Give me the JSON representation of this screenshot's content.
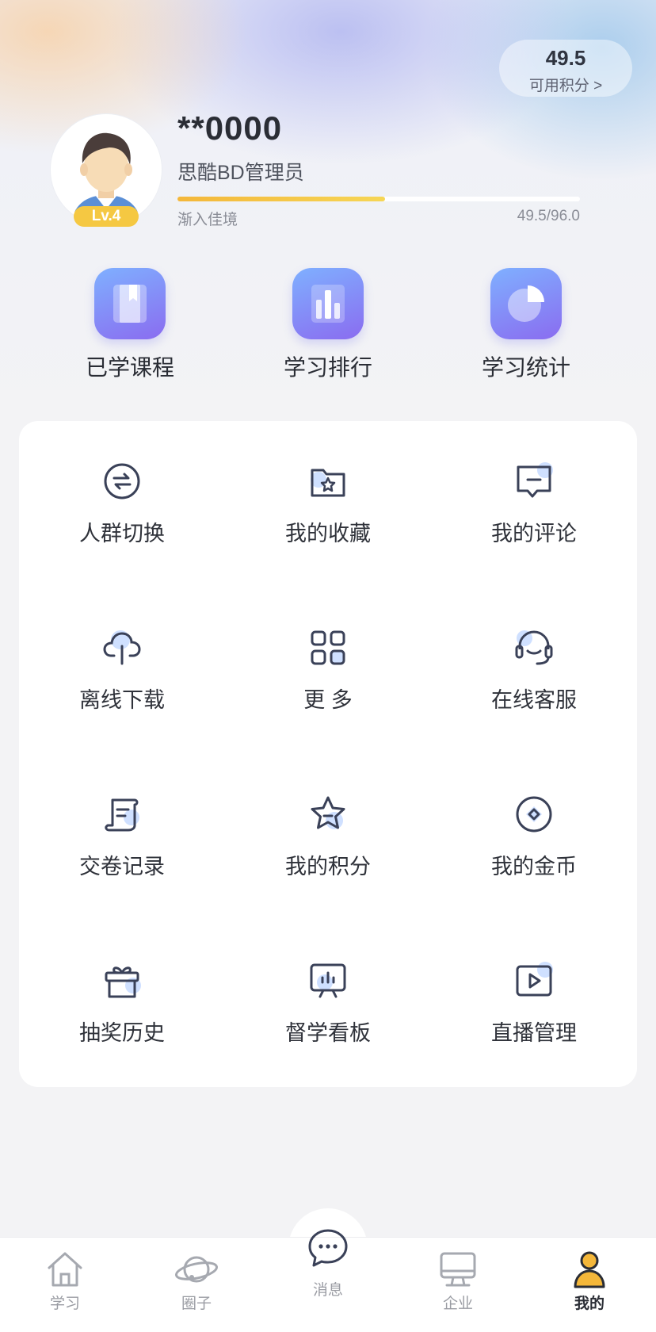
{
  "points": {
    "value": "49.5",
    "label": "可用积分 >"
  },
  "profile": {
    "name": "**0000",
    "role": "思酷BD管理员",
    "level": "Lv.4",
    "rank_title": "渐入佳境",
    "progress_text": "49.5/96.0",
    "progress_fraction": 0.515
  },
  "quick_actions": [
    {
      "label": "已学课程",
      "icon": "book-icon"
    },
    {
      "label": "学习排行",
      "icon": "bar-chart-icon"
    },
    {
      "label": "学习统计",
      "icon": "pie-chart-icon"
    }
  ],
  "menu": [
    {
      "label": "人群切换",
      "icon": "switch-icon"
    },
    {
      "label": "我的收藏",
      "icon": "star-folder-icon"
    },
    {
      "label": "我的评论",
      "icon": "comment-icon"
    },
    {
      "label": "离线下载",
      "icon": "cloud-download-icon"
    },
    {
      "label": "更 多",
      "icon": "grid-icon"
    },
    {
      "label": "在线客服",
      "icon": "headset-icon"
    },
    {
      "label": "交卷记录",
      "icon": "scroll-icon"
    },
    {
      "label": "我的积分",
      "icon": "star-icon"
    },
    {
      "label": "我的金币",
      "icon": "coin-icon"
    },
    {
      "label": "抽奖历史",
      "icon": "gift-icon"
    },
    {
      "label": "督学看板",
      "icon": "dashboard-icon"
    },
    {
      "label": "直播管理",
      "icon": "live-icon"
    }
  ],
  "tabs": [
    {
      "label": "学习",
      "icon": "home-icon"
    },
    {
      "label": "圈子",
      "icon": "planet-icon"
    },
    {
      "label": "消息",
      "icon": "message-icon"
    },
    {
      "label": "企业",
      "icon": "monitor-icon"
    },
    {
      "label": "我的",
      "icon": "person-icon",
      "active": true
    }
  ],
  "colors": {
    "accent": "#f4b73a",
    "icon_gradient_start": "#7fb0ff",
    "icon_gradient_end": "#8a6cf0",
    "icon_stroke": "#3a4158"
  }
}
